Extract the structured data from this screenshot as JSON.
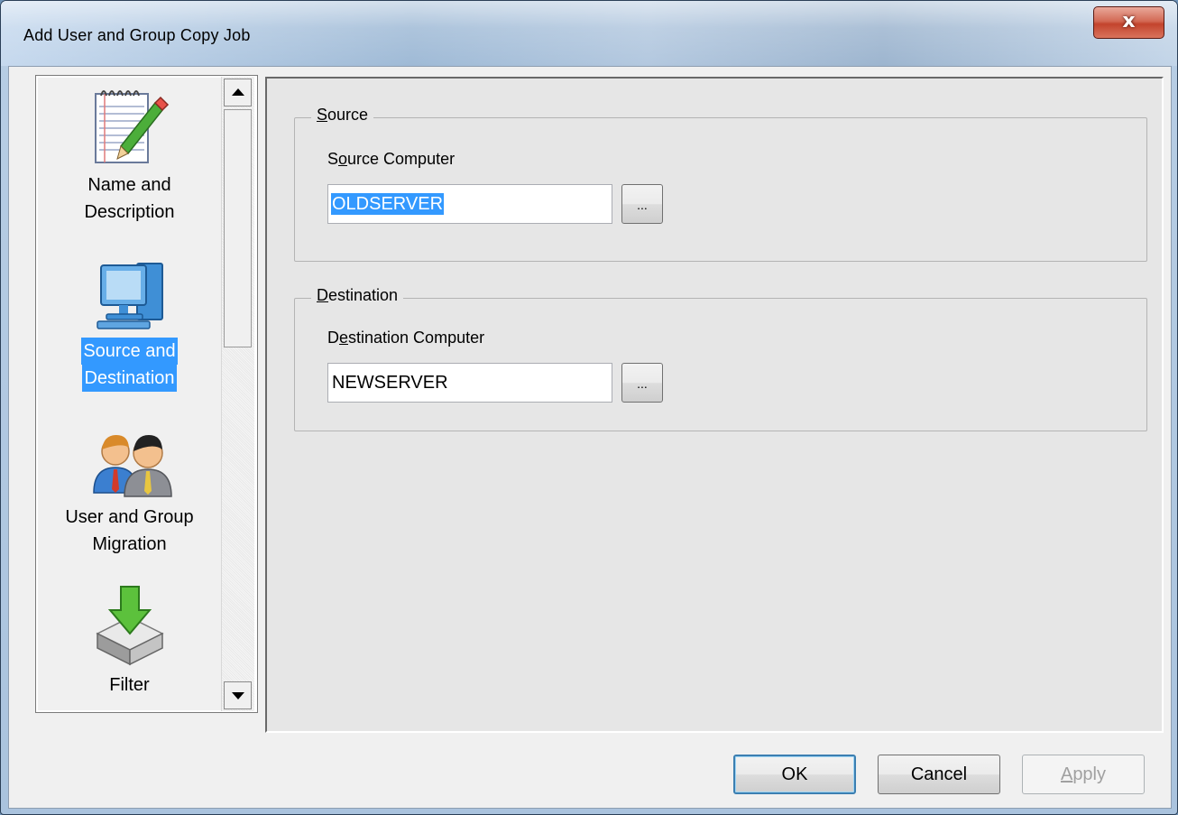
{
  "window": {
    "title": "Add User and Group Copy Job",
    "close_label": "x"
  },
  "nav": {
    "items": [
      {
        "label_line1": "Name and",
        "label_line2": "Description",
        "icon": "notepad-pencil-icon"
      },
      {
        "label_line1": "Source and",
        "label_line2": "Destination",
        "icon": "computer-icon",
        "selected": true
      },
      {
        "label_line1": "User and Group",
        "label_line2": "Migration",
        "icon": "users-icon"
      },
      {
        "label_line1": "Filter",
        "label_line2": "",
        "icon": "filter-arrow-icon"
      }
    ]
  },
  "source": {
    "legend": "Source",
    "legend_key": "S",
    "legend_rest": "ource",
    "field_label_pre": "S",
    "field_label_key": "o",
    "field_label_rest": "urce Computer",
    "value": "OLDSERVER",
    "browse_label": "..."
  },
  "destination": {
    "legend": "Destination",
    "legend_key": "D",
    "legend_rest": "estination",
    "field_label_pre": "D",
    "field_label_key": "e",
    "field_label_rest": "stination Computer",
    "value": "NEWSERVER",
    "browse_label": "..."
  },
  "buttons": {
    "ok": "OK",
    "cancel": "Cancel",
    "apply_key": "A",
    "apply_rest": "pply"
  },
  "colors": {
    "selection": "#3399ff",
    "dialog_bg": "#f0f0f0"
  }
}
